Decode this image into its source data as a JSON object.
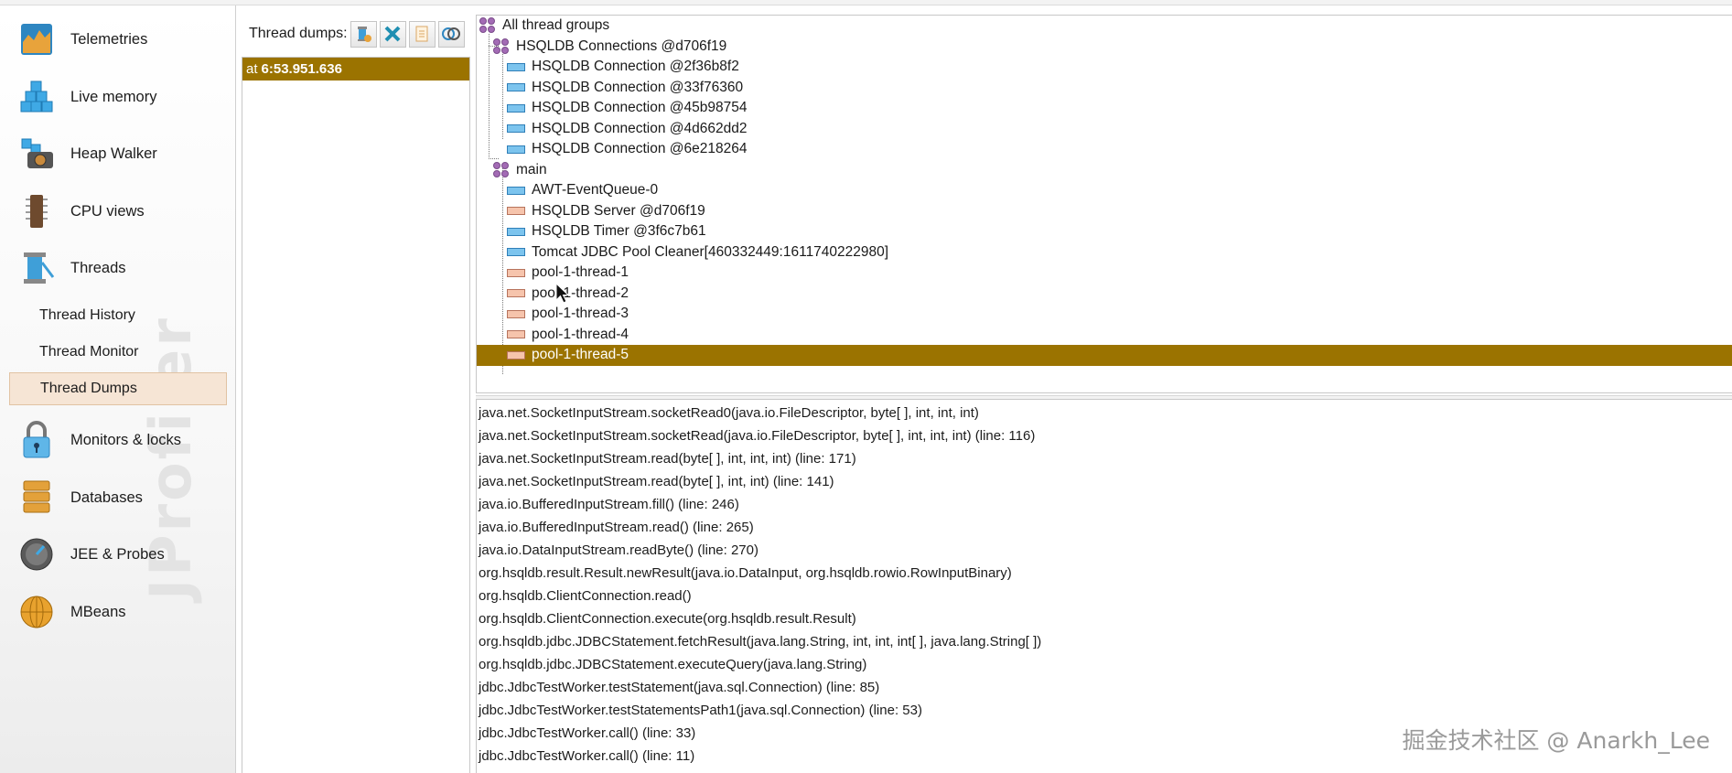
{
  "sidebar": {
    "items": [
      {
        "label": "Telemetries",
        "icon": "telemetries-icon"
      },
      {
        "label": "Live memory",
        "icon": "live-memory-icon"
      },
      {
        "label": "Heap Walker",
        "icon": "heap-walker-icon"
      },
      {
        "label": "CPU views",
        "icon": "cpu-views-icon"
      },
      {
        "label": "Threads",
        "icon": "threads-icon"
      }
    ],
    "thread_subitems": [
      {
        "label": "Thread History",
        "active": false
      },
      {
        "label": "Thread Monitor",
        "active": false
      },
      {
        "label": "Thread Dumps",
        "active": true
      }
    ],
    "lower_items": [
      {
        "label": "Monitors & locks",
        "icon": "lock-icon"
      },
      {
        "label": "Databases",
        "icon": "databases-icon"
      },
      {
        "label": "JEE & Probes",
        "icon": "probes-gauge-icon"
      },
      {
        "label": "MBeans",
        "icon": "mbeans-globe-icon"
      }
    ],
    "watermark": "JProfiler"
  },
  "dumps": {
    "title": "Thread dumps:",
    "buttons": [
      "take-dump-icon",
      "delete-icon",
      "export-icon",
      "compare-icon"
    ],
    "list": [
      {
        "prefix": "at",
        "time": "6:53.951.636",
        "selected": true
      }
    ]
  },
  "tree": {
    "root": "All thread groups",
    "group1": "HSQLDB Connections @d706f19",
    "group1_threads": [
      "HSQLDB Connection @2f36b8f2",
      "HSQLDB Connection @33f76360",
      "HSQLDB Connection @45b98754",
      "HSQLDB Connection @4d662dd2",
      "HSQLDB Connection @6e218264"
    ],
    "group2": "main",
    "group2_threads": [
      {
        "label": "AWT-EventQueue-0",
        "state": "running"
      },
      {
        "label": "HSQLDB Server @d706f19",
        "state": "waiting"
      },
      {
        "label": "HSQLDB Timer @3f6c7b61",
        "state": "running"
      },
      {
        "label": "Tomcat JDBC Pool Cleaner[460332449:1611740222980]",
        "state": "running"
      },
      {
        "label": "pool-1-thread-1",
        "state": "waiting"
      },
      {
        "label": "pool-1-thread-2",
        "state": "waiting"
      },
      {
        "label": "pool-1-thread-3",
        "state": "waiting"
      },
      {
        "label": "pool-1-thread-4",
        "state": "waiting"
      },
      {
        "label": "pool-1-thread-5",
        "state": "waiting",
        "selected": true
      }
    ]
  },
  "stack": [
    "java.net.SocketInputStream.socketRead0(java.io.FileDescriptor, byte[ ], int, int, int)",
    "java.net.SocketInputStream.socketRead(java.io.FileDescriptor, byte[ ], int, int, int) (line: 116)",
    "java.net.SocketInputStream.read(byte[ ], int, int, int) (line: 171)",
    "java.net.SocketInputStream.read(byte[ ], int, int) (line: 141)",
    "java.io.BufferedInputStream.fill() (line: 246)",
    "java.io.BufferedInputStream.read() (line: 265)",
    "java.io.DataInputStream.readByte() (line: 270)",
    "org.hsqldb.result.Result.newResult(java.io.DataInput, org.hsqldb.rowio.RowInputBinary)",
    "org.hsqldb.ClientConnection.read()",
    "org.hsqldb.ClientConnection.execute(org.hsqldb.result.Result)",
    "org.hsqldb.jdbc.JDBCStatement.fetchResult(java.lang.String, int, int, int[ ], java.lang.String[ ])",
    "org.hsqldb.jdbc.JDBCStatement.executeQuery(java.lang.String)",
    "jdbc.JdbcTestWorker.testStatement(java.sql.Connection) (line: 85)",
    "jdbc.JdbcTestWorker.testStatementsPath1(java.sql.Connection) (line: 53)",
    "jdbc.JdbcTestWorker.call() (line: 33)",
    "jdbc.JdbcTestWorker.call() (line: 11)"
  ],
  "credit": "掘金技术社区 @ Anarkh_Lee",
  "colors": {
    "selection": "#9b7300",
    "group": "#a36bb5",
    "running": "#7cc4ee",
    "waiting": "#f6c4ac",
    "active_nav": "#f6e5d5"
  }
}
